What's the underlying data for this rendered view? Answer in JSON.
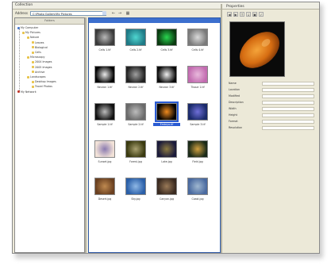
{
  "window": {
    "title": "Collection",
    "toolbar_label": "Address",
    "address_value": "C:\\Photo Gallery\\My Pictures"
  },
  "tree": {
    "header": "Folders",
    "items": [
      {
        "label": "My Computer",
        "indent": 0,
        "icon_color": "#4a7acb"
      },
      {
        "label": "My Pictures",
        "indent": 1,
        "icon_color": "#e8c34a"
      },
      {
        "label": "Nature",
        "indent": 2,
        "icon_color": "#e8c34a"
      },
      {
        "label": "Leaves",
        "indent": 3,
        "icon_color": "#e8c34a"
      },
      {
        "label": "Biological",
        "indent": 3,
        "icon_color": "#e8c34a"
      },
      {
        "label": "Cells",
        "indent": 3,
        "icon_color": "#e8c34a"
      },
      {
        "label": "Microscopy",
        "indent": 2,
        "icon_color": "#e8c34a"
      },
      {
        "label": "2004 Images",
        "indent": 3,
        "icon_color": "#e8c34a"
      },
      {
        "label": "2005 Images",
        "indent": 3,
        "icon_color": "#e8c34a"
      },
      {
        "label": "Archive",
        "indent": 3,
        "icon_color": "#e8c34a"
      },
      {
        "label": "Landscapes",
        "indent": 2,
        "icon_color": "#e8c34a"
      },
      {
        "label": "Desktop Images",
        "indent": 3,
        "icon_color": "#e8c34a"
      },
      {
        "label": "Travel Photos",
        "indent": 3,
        "icon_color": "#e8c34a"
      },
      {
        "label": "My Network",
        "indent": 0,
        "icon_color": "#c0392b"
      }
    ]
  },
  "thumbs": [
    {
      "caption": "Cells 1.tif",
      "colors": [
        "#3a3a3a",
        "#b8b8b8"
      ]
    },
    {
      "caption": "Cells 2.tif",
      "colors": [
        "#1f7a86",
        "#4fd6d0"
      ]
    },
    {
      "caption": "Cells 3.tif",
      "colors": [
        "#0a3a10",
        "#29d650"
      ]
    },
    {
      "caption": "Cells 4.tif",
      "colors": [
        "#7a7a7a",
        "#dadada"
      ]
    },
    {
      "caption": "Neuron 1.tif",
      "colors": [
        "#050505",
        "#eaeaea"
      ]
    },
    {
      "caption": "Neuron 2.tif",
      "colors": [
        "#222222",
        "#a0a0a0"
      ]
    },
    {
      "caption": "Neuron 3.tif",
      "colors": [
        "#0c0c0c",
        "#f0f0f0"
      ]
    },
    {
      "caption": "Tissue 1.tif",
      "colors": [
        "#c26bb0",
        "#e8b9dc"
      ]
    },
    {
      "caption": "Sample 1.tif",
      "colors": [
        "#101010",
        "#bbbbbb"
      ]
    },
    {
      "caption": "Sample 2.tif",
      "colors": [
        "#6a6a6a",
        "#bcbcbc"
      ]
    },
    {
      "caption": "Embryo.tif",
      "colors": [
        "#000000",
        "#ef8a1e"
      ]
    },
    {
      "caption": "Sample 3.tif",
      "colors": [
        "#1a2a6a",
        "#6f6fd8"
      ]
    },
    {
      "caption": "Sunset.jpg",
      "colors": [
        "#f2e2d8",
        "#8a7ab0"
      ]
    },
    {
      "caption": "Forest.jpg",
      "colors": [
        "#3a3a10",
        "#a8a070"
      ]
    },
    {
      "caption": "Lake.jpg",
      "colors": [
        "#1a1a3a",
        "#8c7a40"
      ]
    },
    {
      "caption": "Field.jpg",
      "colors": [
        "#1a2a18",
        "#d0a040"
      ]
    },
    {
      "caption": "Desert.jpg",
      "colors": [
        "#6a4020",
        "#c08a50"
      ]
    },
    {
      "caption": "Sky.jpg",
      "colors": [
        "#2a5fa8",
        "#8fb8e6"
      ]
    },
    {
      "caption": "Canyon.jpg",
      "colors": [
        "#3a2a20",
        "#9a7a58"
      ]
    },
    {
      "caption": "Coast.jpg",
      "colors": [
        "#4a6aa0",
        "#a0b8d0"
      ]
    }
  ],
  "selected_index": 10,
  "inspector": {
    "title": "Properties",
    "buttons": [
      "◀",
      "▶",
      "↑",
      "↓",
      "▣",
      "✓"
    ],
    "fields": [
      {
        "label": "Name"
      },
      {
        "label": "Location"
      },
      {
        "label": "Modified"
      },
      {
        "label": "Description"
      },
      {
        "label": "Width"
      },
      {
        "label": "Height"
      },
      {
        "label": "Format"
      },
      {
        "label": "Resolution"
      }
    ]
  }
}
